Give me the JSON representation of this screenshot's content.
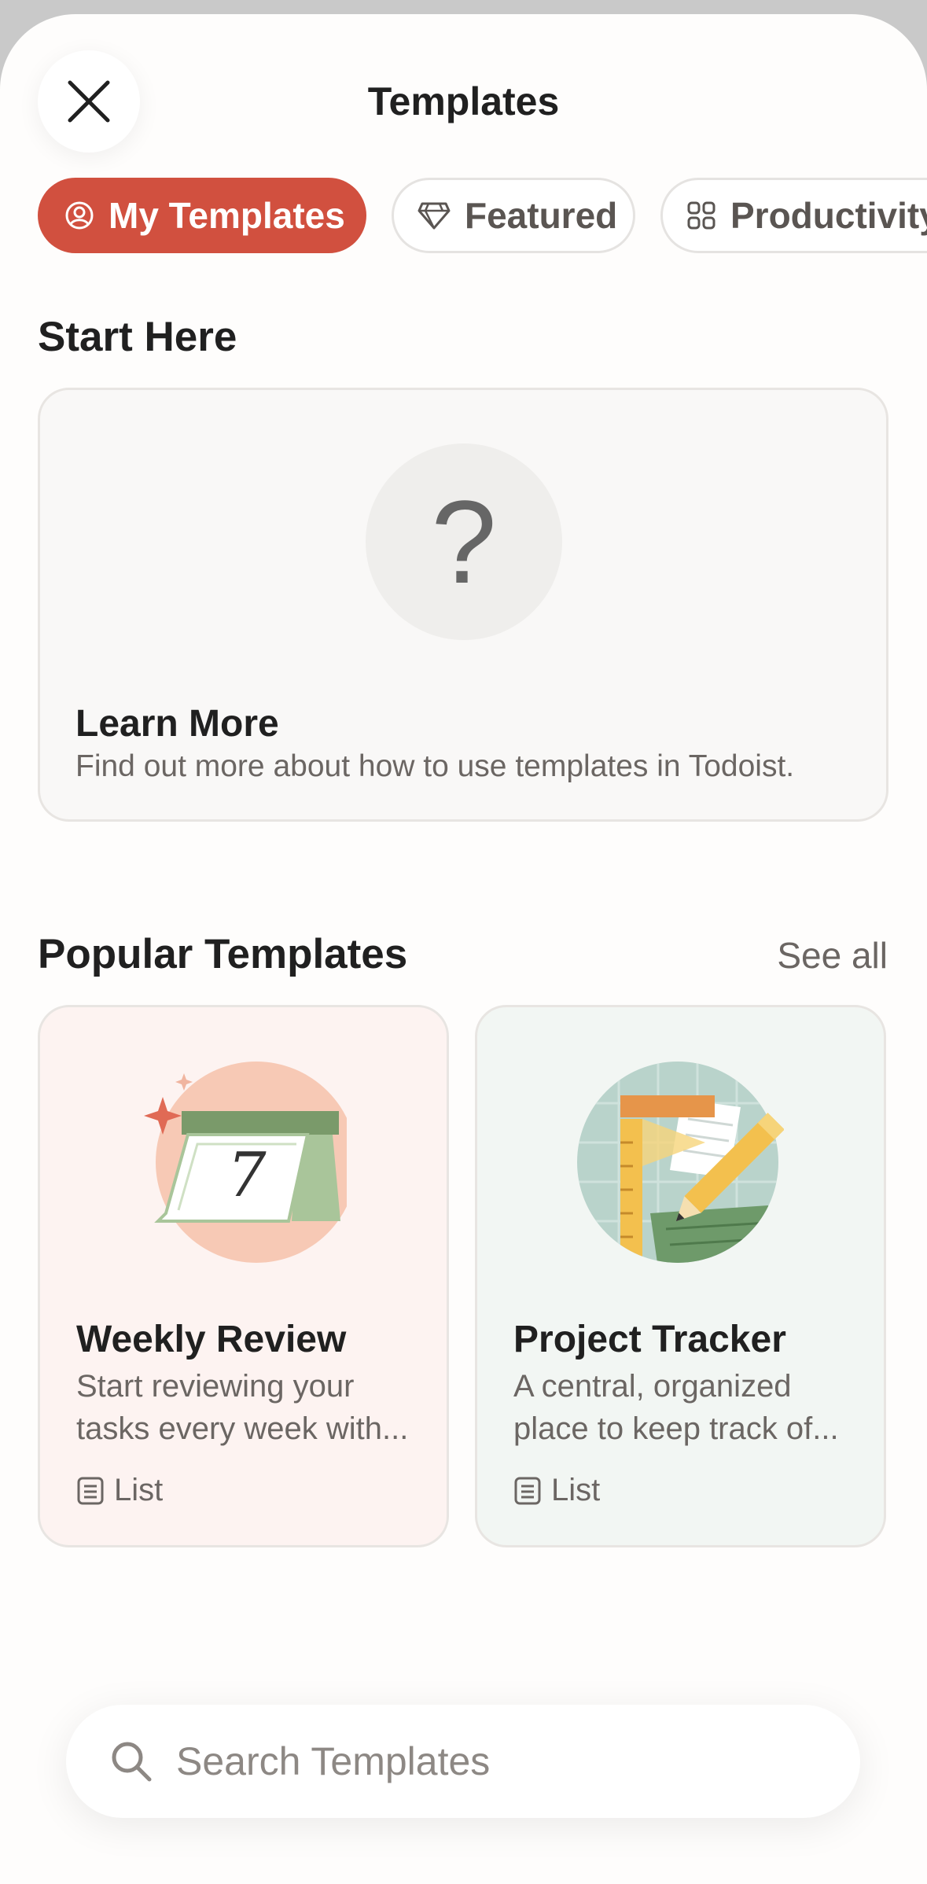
{
  "header": {
    "title": "Templates",
    "close_icon": "close-icon"
  },
  "chips": [
    {
      "label": "My Templates",
      "icon": "user-circle-icon",
      "active": true
    },
    {
      "label": "Featured",
      "icon": "gem-icon",
      "active": false
    },
    {
      "label": "Productivity",
      "icon": "grid-icon",
      "active": false
    }
  ],
  "start_here": {
    "heading": "Start Here",
    "learn_more": {
      "glyph": "?",
      "title": "Learn More",
      "description": "Find out more about how to use templates in Todoist."
    }
  },
  "popular": {
    "heading": "Popular Templates",
    "see_all": "See all",
    "cards": [
      {
        "title": "Weekly Review",
        "description": "Start reviewing your tasks every week with...",
        "type": "List",
        "calendar_day": "7",
        "illustration": "calendar-illustration",
        "color": "#fdf3f1"
      },
      {
        "title": "Project Tracker",
        "description": "A central, organized place to keep track of...",
        "type": "List",
        "illustration": "ruler-pencil-illustration",
        "color": "#f2f6f3"
      }
    ]
  },
  "search": {
    "placeholder": "Search Templates",
    "value": ""
  },
  "colors": {
    "accent": "#d1503f",
    "text": "#202020",
    "muted": "#6b6663"
  }
}
